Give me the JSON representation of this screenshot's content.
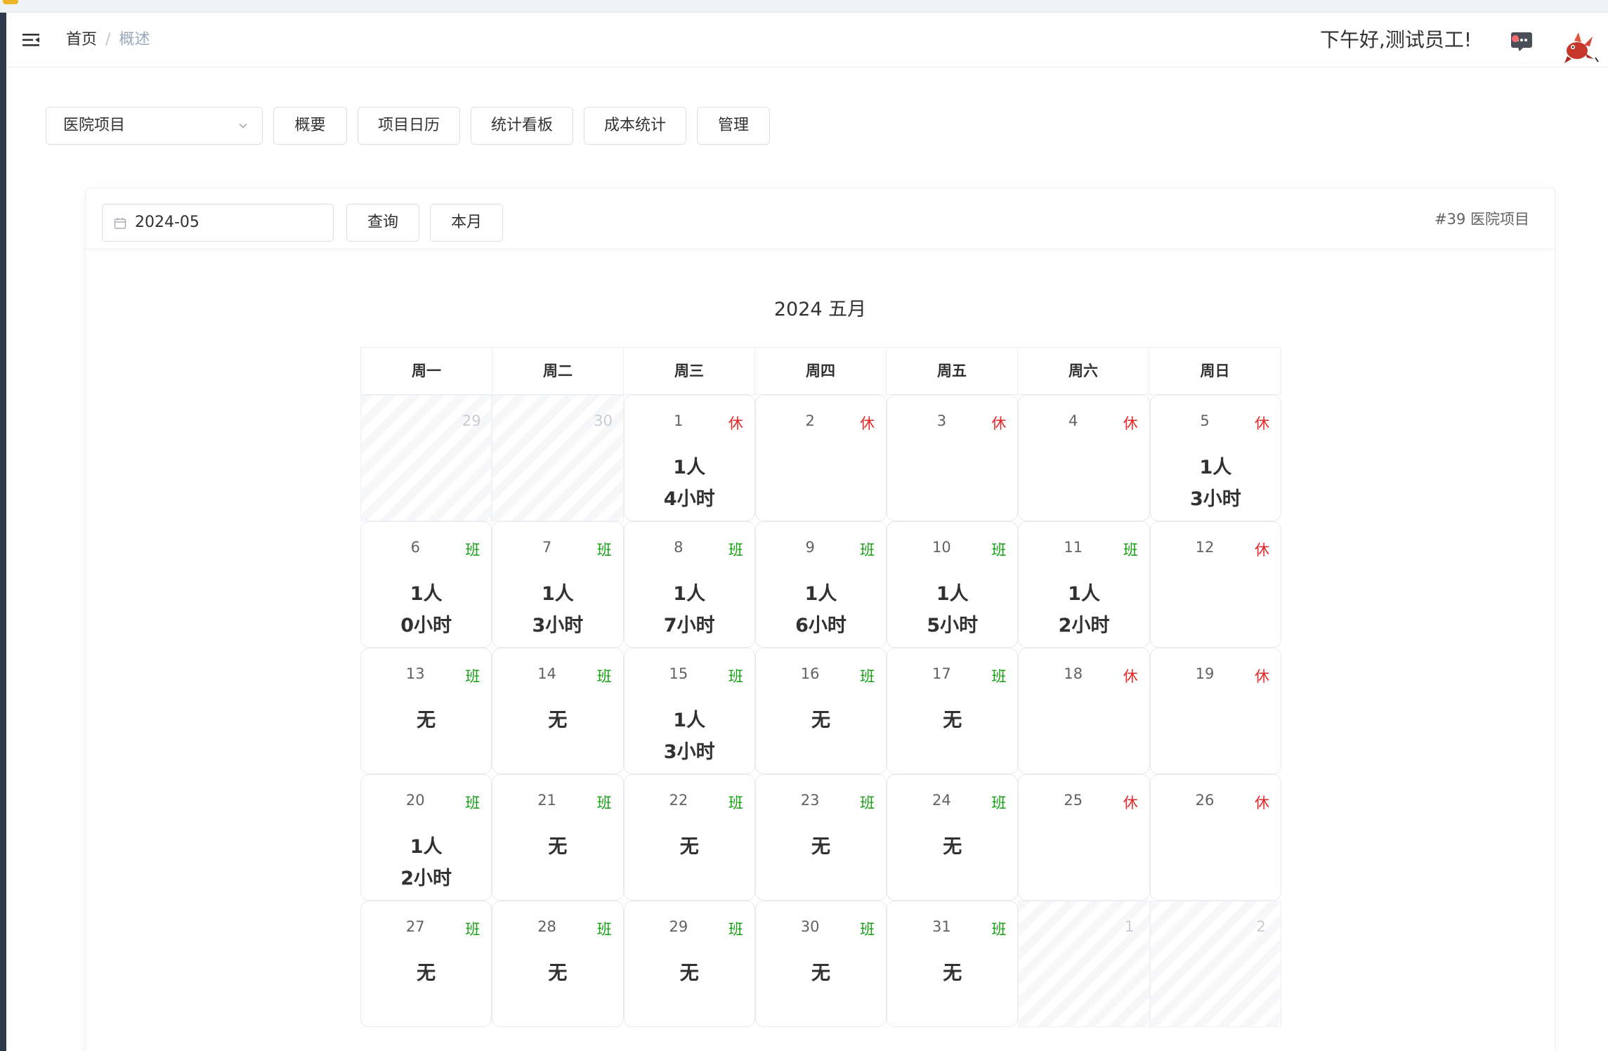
{
  "navbar": {
    "breadcrumb_home": "首页",
    "breadcrumb_sep": "/",
    "breadcrumb_current": "概述",
    "greeting": "下午好,测试员工!",
    "message_icon": "chat-bubble-icon",
    "notification_color": "#f56c6c"
  },
  "controls": {
    "project_select": "医院项目",
    "tabs": [
      "概要",
      "项目日历",
      "统计看板",
      "成本统计",
      "管理"
    ]
  },
  "calendar_panel": {
    "date_value": "2024-05",
    "query_label": "查询",
    "this_month_label": "本月",
    "project_label": "#39 医院项目",
    "title": "2024 五月",
    "weekdays": [
      "周一",
      "周二",
      "周三",
      "周四",
      "周五",
      "周六",
      "周日"
    ],
    "days": [
      {
        "num": "29",
        "other": true,
        "tag": "",
        "type": "",
        "people": "",
        "hours": ""
      },
      {
        "num": "30",
        "other": true,
        "tag": "",
        "type": "",
        "people": "",
        "hours": ""
      },
      {
        "num": "1",
        "other": false,
        "tag": "休",
        "type": "xiu",
        "people": "1人",
        "hours": "4小时"
      },
      {
        "num": "2",
        "other": false,
        "tag": "休",
        "type": "xiu",
        "people": "",
        "hours": ""
      },
      {
        "num": "3",
        "other": false,
        "tag": "休",
        "type": "xiu",
        "people": "",
        "hours": ""
      },
      {
        "num": "4",
        "other": false,
        "tag": "休",
        "type": "xiu",
        "people": "",
        "hours": ""
      },
      {
        "num": "5",
        "other": false,
        "tag": "休",
        "type": "xiu",
        "people": "1人",
        "hours": "3小时"
      },
      {
        "num": "6",
        "other": false,
        "tag": "班",
        "type": "ban",
        "people": "1人",
        "hours": "0小时"
      },
      {
        "num": "7",
        "other": false,
        "tag": "班",
        "type": "ban",
        "people": "1人",
        "hours": "3小时"
      },
      {
        "num": "8",
        "other": false,
        "tag": "班",
        "type": "ban",
        "people": "1人",
        "hours": "7小时"
      },
      {
        "num": "9",
        "other": false,
        "tag": "班",
        "type": "ban",
        "people": "1人",
        "hours": "6小时"
      },
      {
        "num": "10",
        "other": false,
        "tag": "班",
        "type": "ban",
        "people": "1人",
        "hours": "5小时"
      },
      {
        "num": "11",
        "other": false,
        "tag": "班",
        "type": "ban",
        "people": "1人",
        "hours": "2小时"
      },
      {
        "num": "12",
        "other": false,
        "tag": "休",
        "type": "xiu",
        "people": "",
        "hours": ""
      },
      {
        "num": "13",
        "other": false,
        "tag": "班",
        "type": "ban",
        "people": "无",
        "hours": ""
      },
      {
        "num": "14",
        "other": false,
        "tag": "班",
        "type": "ban",
        "people": "无",
        "hours": ""
      },
      {
        "num": "15",
        "other": false,
        "tag": "班",
        "type": "ban",
        "people": "1人",
        "hours": "3小时"
      },
      {
        "num": "16",
        "other": false,
        "tag": "班",
        "type": "ban",
        "people": "无",
        "hours": ""
      },
      {
        "num": "17",
        "other": false,
        "tag": "班",
        "type": "ban",
        "people": "无",
        "hours": ""
      },
      {
        "num": "18",
        "other": false,
        "tag": "休",
        "type": "xiu",
        "people": "",
        "hours": ""
      },
      {
        "num": "19",
        "other": false,
        "tag": "休",
        "type": "xiu",
        "people": "",
        "hours": ""
      },
      {
        "num": "20",
        "other": false,
        "tag": "班",
        "type": "ban",
        "people": "1人",
        "hours": "2小时"
      },
      {
        "num": "21",
        "other": false,
        "tag": "班",
        "type": "ban",
        "people": "无",
        "hours": ""
      },
      {
        "num": "22",
        "other": false,
        "tag": "班",
        "type": "ban",
        "people": "无",
        "hours": ""
      },
      {
        "num": "23",
        "other": false,
        "tag": "班",
        "type": "ban",
        "people": "无",
        "hours": ""
      },
      {
        "num": "24",
        "other": false,
        "tag": "班",
        "type": "ban",
        "people": "无",
        "hours": ""
      },
      {
        "num": "25",
        "other": false,
        "tag": "休",
        "type": "xiu",
        "people": "",
        "hours": ""
      },
      {
        "num": "26",
        "other": false,
        "tag": "休",
        "type": "xiu",
        "people": "",
        "hours": ""
      },
      {
        "num": "27",
        "other": false,
        "tag": "班",
        "type": "ban",
        "people": "无",
        "hours": ""
      },
      {
        "num": "28",
        "other": false,
        "tag": "班",
        "type": "ban",
        "people": "无",
        "hours": ""
      },
      {
        "num": "29",
        "other": false,
        "tag": "班",
        "type": "ban",
        "people": "无",
        "hours": ""
      },
      {
        "num": "30",
        "other": false,
        "tag": "班",
        "type": "ban",
        "people": "无",
        "hours": ""
      },
      {
        "num": "31",
        "other": false,
        "tag": "班",
        "type": "ban",
        "people": "无",
        "hours": ""
      },
      {
        "num": "1",
        "other": true,
        "tag": "",
        "type": "",
        "people": "",
        "hours": ""
      },
      {
        "num": "2",
        "other": true,
        "tag": "",
        "type": "",
        "people": "",
        "hours": ""
      }
    ]
  },
  "colors": {
    "rest_tag": "#e62727",
    "work_tag": "#12a012",
    "sidebar": "#2f3b4c"
  }
}
